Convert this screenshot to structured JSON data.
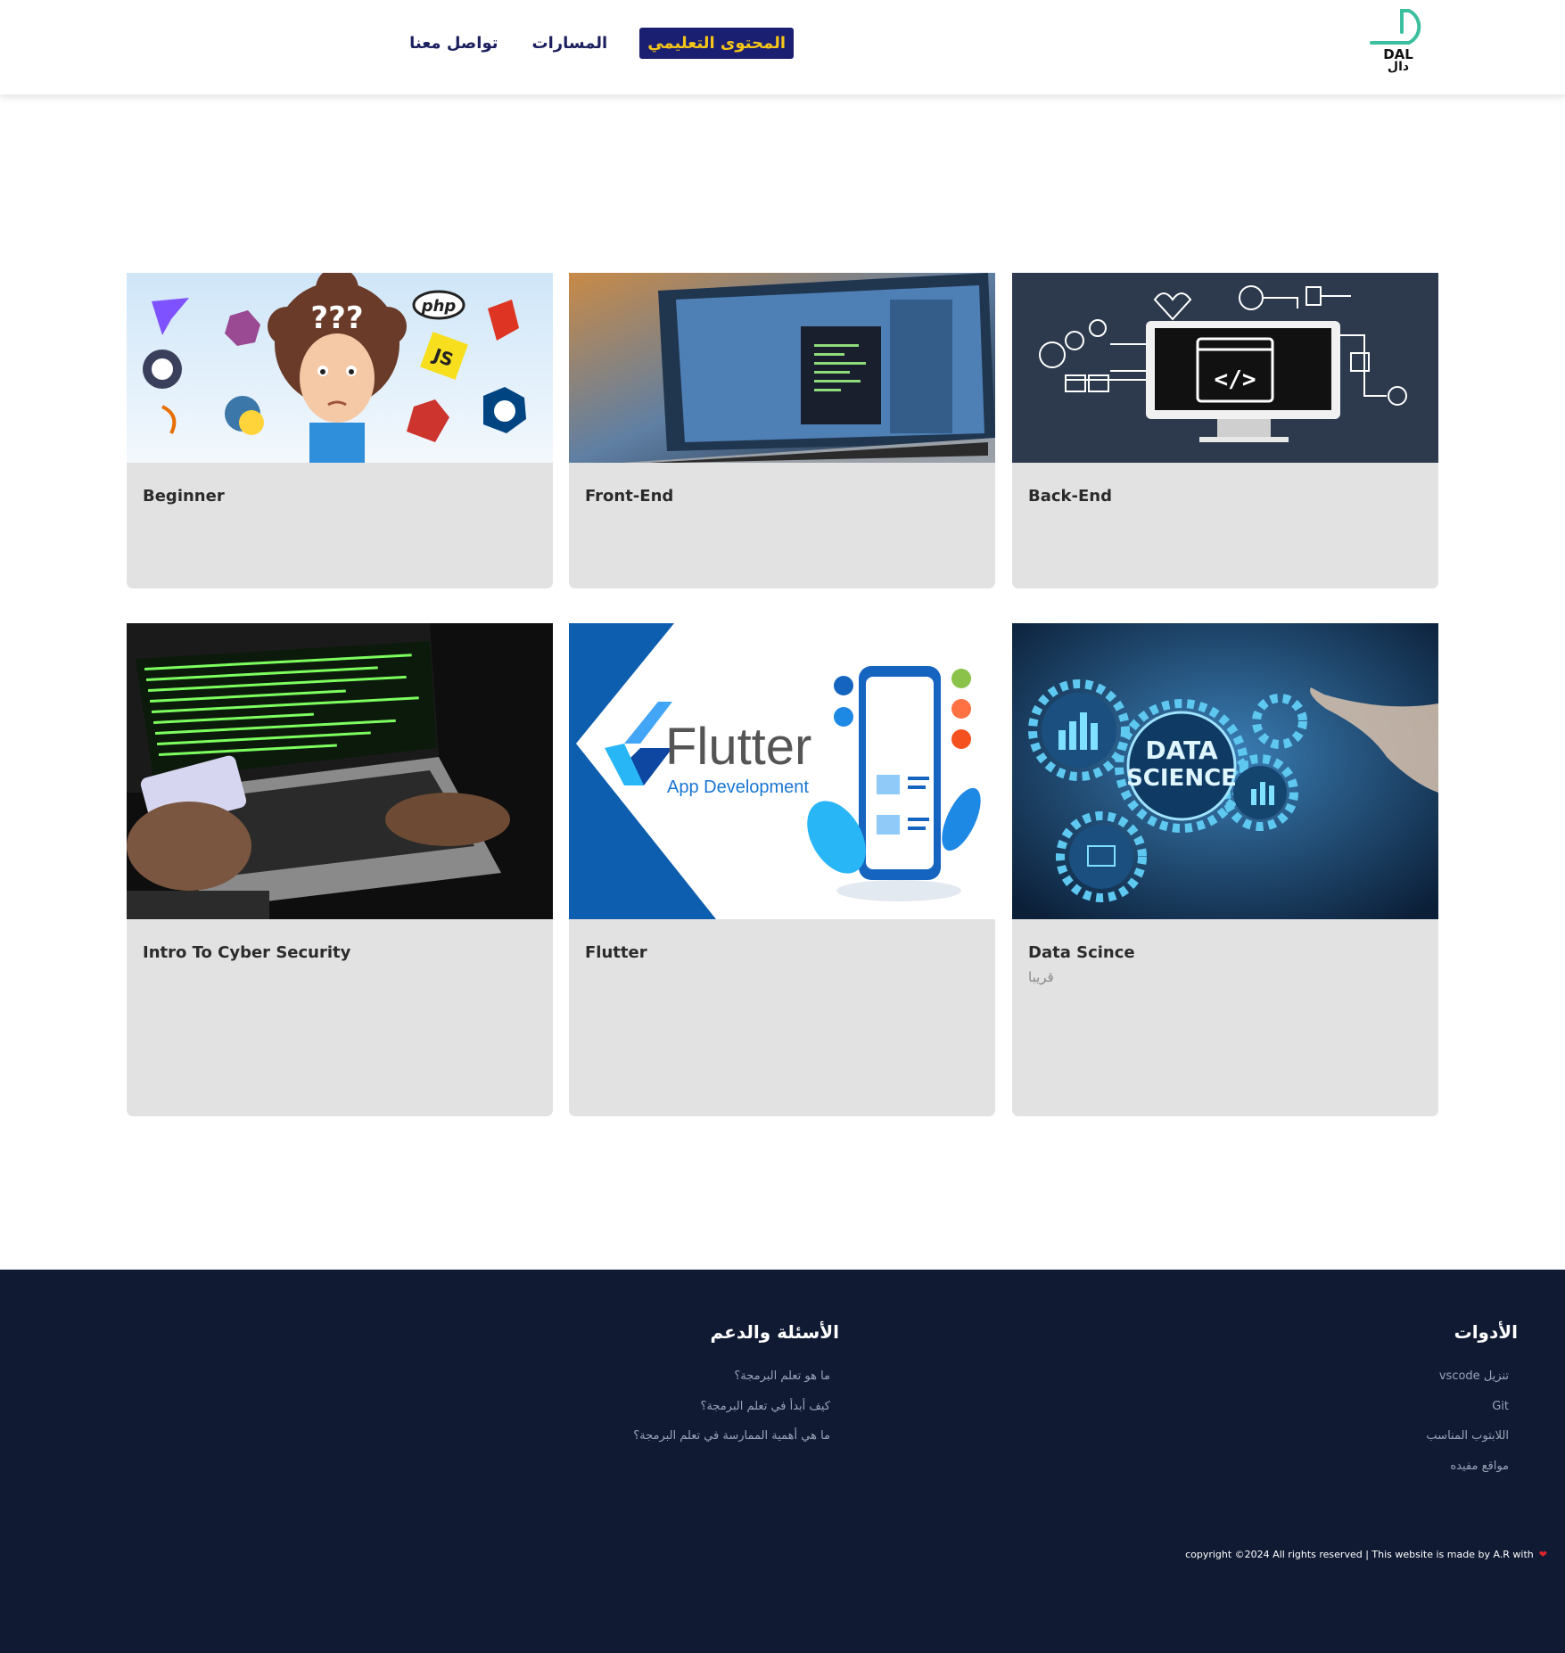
{
  "header": {
    "logo_en": "DAL",
    "logo_ar": "دال",
    "nav": [
      {
        "label": "المحتوى التعليمي",
        "active": true
      },
      {
        "label": "المسارات",
        "active": false
      },
      {
        "label": "تواصل معنا",
        "active": false
      }
    ],
    "accent_color": "#1a1f71",
    "active_text_color": "#f5c518",
    "logo_color": "#3bbf9e"
  },
  "cards": [
    {
      "title": "Beginner",
      "subtitle": "",
      "image": "programming-languages-illustration"
    },
    {
      "title": "Front-End",
      "subtitle": "",
      "image": "laptop-code-photo"
    },
    {
      "title": "Back-End",
      "subtitle": "",
      "image": "monitor-code-diagram"
    },
    {
      "title": "Intro To Cyber Security",
      "subtitle": "",
      "image": "hacker-laptop-photo"
    },
    {
      "title": "Flutter",
      "subtitle": "",
      "image": "flutter-app-development-banner",
      "image_text": {
        "brand": "Flutter",
        "tag": "App Development"
      }
    },
    {
      "title": "Data Scince",
      "subtitle": "قريبا",
      "image": "data-science-gears-photo",
      "image_text": {
        "line1": "DATA",
        "line2": "SCIENCE"
      }
    }
  ],
  "footer": {
    "tools": {
      "title": "الأدوات",
      "links": [
        "تنزيل vscode",
        "Git",
        "اللابتوب المناسب",
        "مواقع مفيده"
      ]
    },
    "faq": {
      "title": "الأسئلة والدعم",
      "links": [
        "ما هو تعلم البرمجة؟",
        "كيف أبدأ في تعلم البرمجة؟",
        "ما هي أهمية الممارسة في تعلم البرمجة؟"
      ]
    },
    "copyright": "copyright ©2024 All rights reserved | This website is made by A.R with",
    "background": "#101a33"
  }
}
